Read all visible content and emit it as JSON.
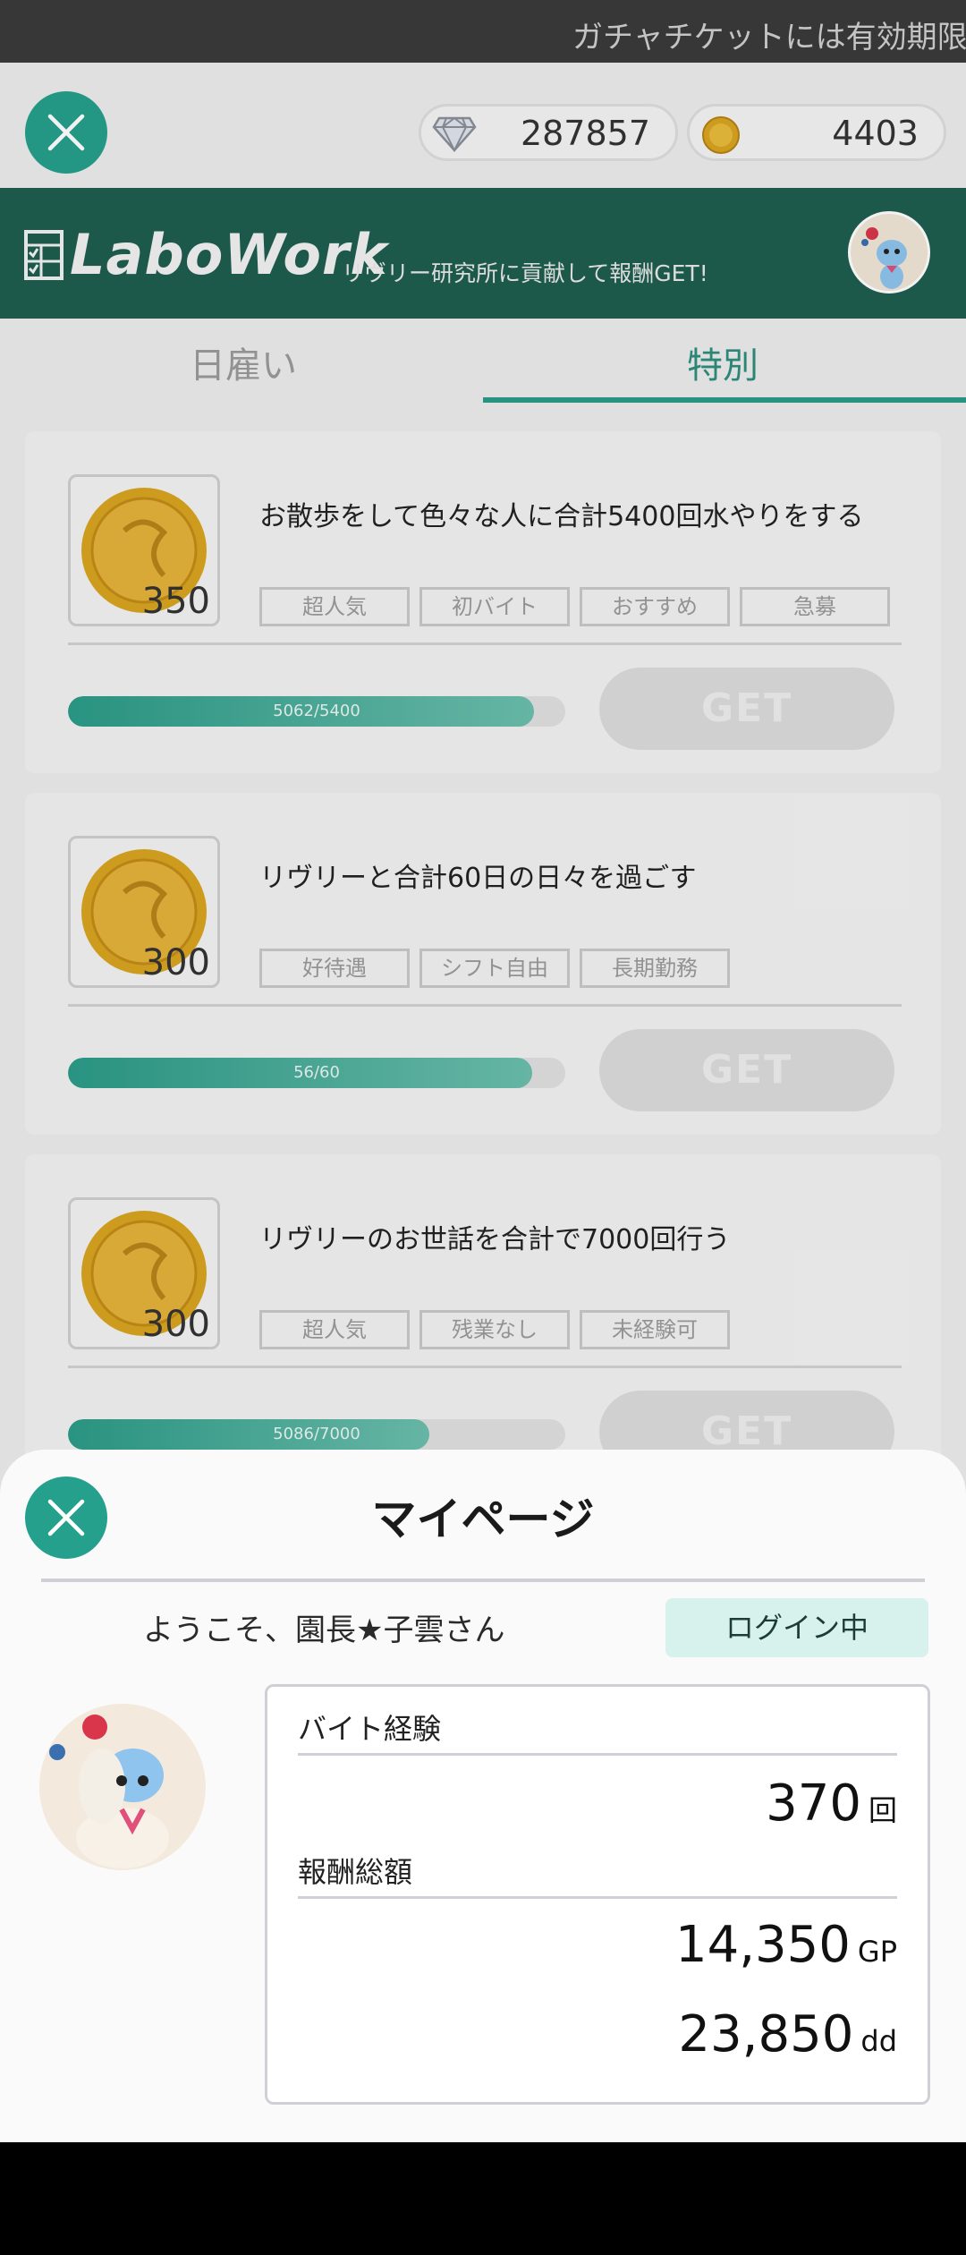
{
  "ticker": {
    "text": "ガチャチケットには有効期限"
  },
  "currency": {
    "gems": "287857",
    "coins": "4403"
  },
  "header": {
    "logo": "LaboWork",
    "tagline": "リヴリー研究所に貢献して報酬GET!"
  },
  "tabs": [
    {
      "label": "日雇い",
      "active": false
    },
    {
      "label": "特別",
      "active": true
    }
  ],
  "tasks": [
    {
      "reward": "350",
      "title": "お散歩をして色々な人に合計5400回水やりをする",
      "tags": [
        "超人気",
        "初バイト",
        "おすすめ",
        "急募"
      ],
      "progress_label": "5062/5400",
      "progress": 0.937,
      "button": "GET"
    },
    {
      "reward": "300",
      "title": "リヴリーと合計60日の日々を過ごす",
      "tags": [
        "好待遇",
        "シフト自由",
        "長期勤務"
      ],
      "progress_label": "56/60",
      "progress": 0.933,
      "button": "GET"
    },
    {
      "reward": "300",
      "title": "リヴリーのお世話を合計で7000回行う",
      "tags": [
        "超人気",
        "残業なし",
        "未経験可"
      ],
      "progress_label": "5086/7000",
      "progress": 0.727,
      "button": "GET"
    }
  ],
  "mypage": {
    "title": "マイページ",
    "welcome": "ようこそ、園長★子雲さん",
    "status": "ログイン中",
    "experience_label": "バイト経験",
    "experience_value": "370",
    "experience_unit": "回",
    "reward_label": "報酬総額",
    "gp_value": "14,350",
    "gp_unit": "GP",
    "dd_value": "23,850",
    "dd_unit": "dd"
  },
  "colors": {
    "accent": "#25a08c",
    "header_bg": "#1e5e50",
    "progress": "#2c9b88"
  }
}
